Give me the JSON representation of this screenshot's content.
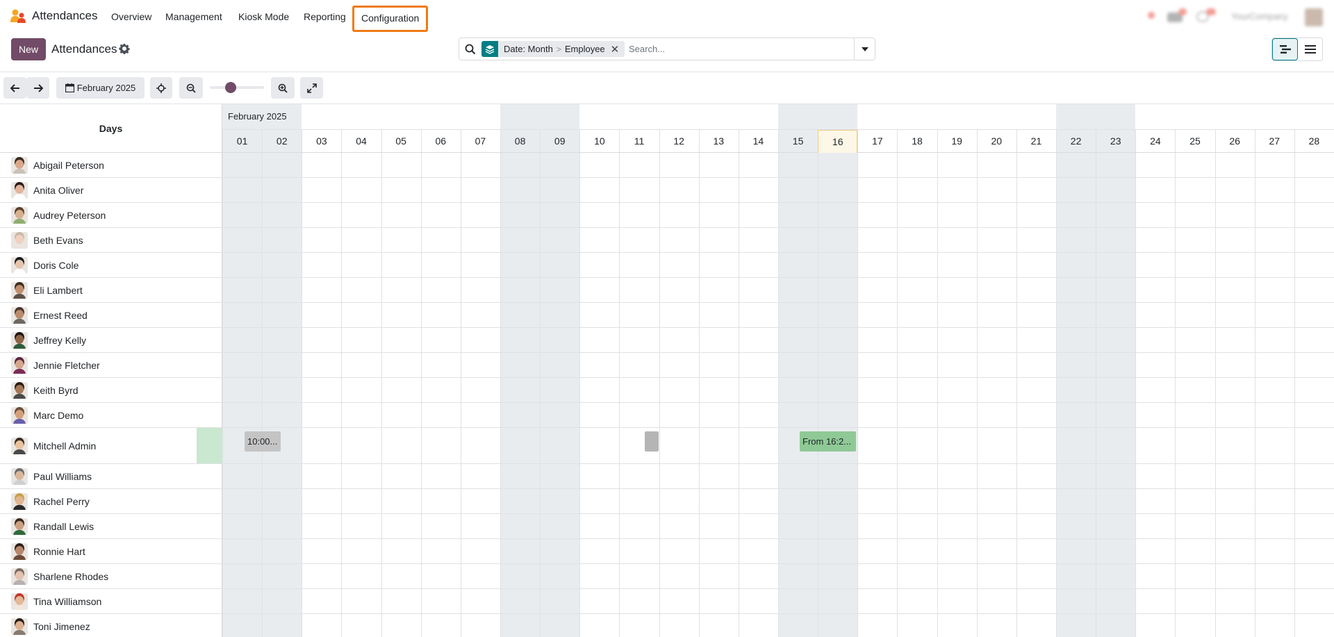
{
  "app": {
    "name": "Attendances",
    "menu": [
      "Overview",
      "Management",
      "Kiosk Mode",
      "Reporting",
      "Configuration"
    ],
    "company": "YourCompany"
  },
  "control": {
    "new_label": "New",
    "title": "Attendances",
    "facet": {
      "first": "Date: Month",
      "sep": ">",
      "second": "Employee"
    },
    "search_placeholder": "Search..."
  },
  "toolbar": {
    "period_label": "February 2025",
    "zoom_level": 0.35
  },
  "gantt": {
    "rows_header": "Days",
    "month_label": "February 2025",
    "days": [
      "01",
      "02",
      "03",
      "04",
      "05",
      "06",
      "07",
      "08",
      "09",
      "10",
      "11",
      "12",
      "13",
      "14",
      "15",
      "16",
      "17",
      "18",
      "19",
      "20",
      "21",
      "22",
      "23",
      "24",
      "25",
      "26",
      "27",
      "28"
    ],
    "weekend_days": [
      "01",
      "02",
      "08",
      "09",
      "15",
      "16",
      "22",
      "23"
    ],
    "today": "16",
    "employees": [
      {
        "name": "Abigail Peterson",
        "skin": "#d9a88a",
        "hair": "#3b2a22",
        "shirt": "#c9c1b8"
      },
      {
        "name": "Anita Oliver",
        "skin": "#e2b59c",
        "hair": "#2a1d18",
        "shirt": "#ffffff"
      },
      {
        "name": "Audrey Peterson",
        "skin": "#d8b08f",
        "hair": "#5a3f2c",
        "shirt": "#8fae6e"
      },
      {
        "name": "Beth Evans",
        "skin": "#f0d0c0",
        "hair": "#c9b8a8",
        "shirt": "#ede4dd"
      },
      {
        "name": "Doris Cole",
        "skin": "#e5c4ae",
        "hair": "#1a1a1a",
        "shirt": "#ffffff"
      },
      {
        "name": "Eli Lambert",
        "skin": "#c08e6d",
        "hair": "#3d2b20",
        "shirt": "#5e5148"
      },
      {
        "name": "Ernest Reed",
        "skin": "#b98b6b",
        "hair": "#4a3528",
        "shirt": "#6f6862"
      },
      {
        "name": "Jeffrey Kelly",
        "skin": "#8e6446",
        "hair": "#201611",
        "shirt": "#2e5b3a"
      },
      {
        "name": "Jennie Fletcher",
        "skin": "#d5a58c",
        "hair": "#5b2340",
        "shirt": "#7a2d55"
      },
      {
        "name": "Keith Byrd",
        "skin": "#a67856",
        "hair": "#2a1d15",
        "shirt": "#4a4a4a"
      },
      {
        "name": "Marc Demo",
        "skin": "#d4a07a",
        "hair": "#6a4f3a",
        "shirt": "#6a5fa8"
      },
      {
        "name": "Mitchell Admin",
        "skin": "#e7c39e",
        "hair": "#3a2a20",
        "shirt": "#4a4a4a"
      },
      {
        "name": "Paul Williams",
        "skin": "#d9b79a",
        "hair": "#6c6c6c",
        "shirt": "#d0d0d0"
      },
      {
        "name": "Rachel Perry",
        "skin": "#e0b58f",
        "hair": "#c9a04a",
        "shirt": "#2a2a2a"
      },
      {
        "name": "Randall Lewis",
        "skin": "#caa080",
        "hair": "#3a2a1e",
        "shirt": "#2f6a3a"
      },
      {
        "name": "Ronnie Hart",
        "skin": "#b6876a",
        "hair": "#2b1e16",
        "shirt": "#6e4a3a"
      },
      {
        "name": "Sharlene Rhodes",
        "skin": "#e4c2b0",
        "hair": "#7a6a60",
        "shirt": "#b8b0b0"
      },
      {
        "name": "Tina Williamson",
        "skin": "#e6b898",
        "hair": "#c0392b",
        "shirt": "#f2e6dc"
      },
      {
        "name": "Toni Jimenez",
        "skin": "#ddb090",
        "hair": "#2a1b14",
        "shirt": "#8a7a70"
      }
    ],
    "mitchell_pills": [
      {
        "text": "",
        "start_day": "31",
        "color": "#c9e8cf"
      },
      {
        "text": "10:00...",
        "start_day": "01",
        "color": "#c4c4c4"
      },
      {
        "text": "",
        "start_day": "11",
        "color": "#b5b5b5"
      },
      {
        "text": "From 16:2...",
        "start_day": "15",
        "color": "#8fc996"
      }
    ]
  }
}
